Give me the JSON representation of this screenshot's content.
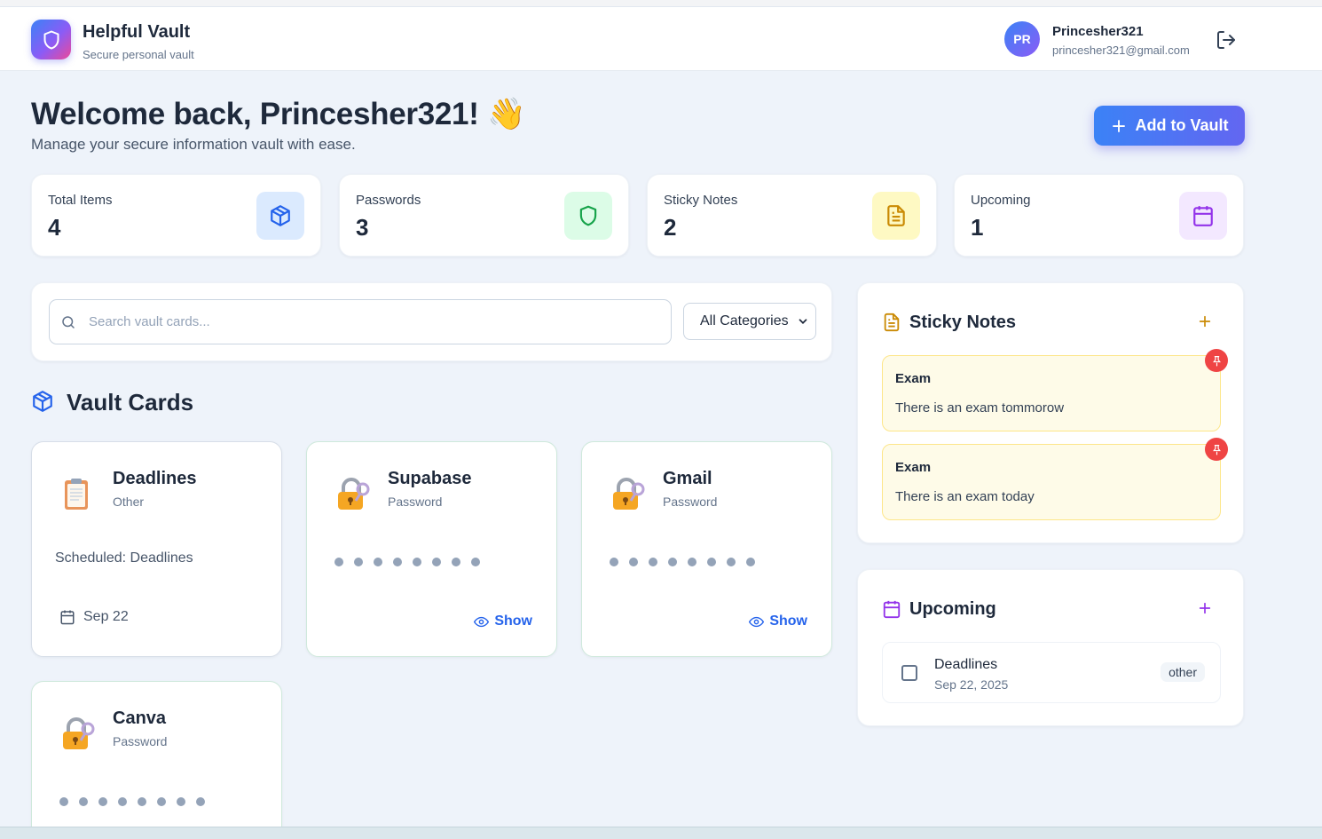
{
  "app": {
    "name": "Helpful Vault",
    "subtitle": "Secure personal vault"
  },
  "user": {
    "initials": "PR",
    "name": "Princesher321",
    "email": "princesher321@gmail.com"
  },
  "welcome": {
    "title": "Welcome back, Princesher321! 👋",
    "subtitle": "Manage your secure information vault with ease.",
    "add_label": "Add to Vault"
  },
  "stats": [
    {
      "label": "Total Items",
      "value": "4",
      "icon": "cube-icon",
      "color": "#2563eb",
      "bg": "#dbeafe"
    },
    {
      "label": "Passwords",
      "value": "3",
      "icon": "shield-icon",
      "color": "#16a34a",
      "bg": "#dcfce7"
    },
    {
      "label": "Sticky Notes",
      "value": "2",
      "icon": "note-icon",
      "color": "#ca8a04",
      "bg": "#fef9c3"
    },
    {
      "label": "Upcoming",
      "value": "1",
      "icon": "calendar-icon",
      "color": "#9333ea",
      "bg": "#f3e8ff"
    }
  ],
  "search": {
    "placeholder": "Search vault cards...",
    "category": "All Categories"
  },
  "vault": {
    "title": "Vault Cards",
    "cards": [
      {
        "title": "Deadlines",
        "category": "Other",
        "text": "Scheduled: Deadlines",
        "date": "Sep 22",
        "icon": "clipboard-icon"
      },
      {
        "title": "Supabase",
        "category": "Password",
        "show": "Show",
        "icon": "lock-icon"
      },
      {
        "title": "Gmail",
        "category": "Password",
        "show": "Show",
        "icon": "lock-icon"
      },
      {
        "title": "Canva",
        "category": "Password",
        "icon": "lock-icon"
      }
    ]
  },
  "sticky": {
    "title": "Sticky Notes",
    "notes": [
      {
        "title": "Exam",
        "body": "There is an exam tommorow"
      },
      {
        "title": "Exam",
        "body": "There is an exam today"
      }
    ]
  },
  "upcoming": {
    "title": "Upcoming",
    "items": [
      {
        "title": "Deadlines",
        "date": "Sep 22, 2025",
        "tag": "other"
      }
    ]
  },
  "colors": {
    "primary": "#3b82f6",
    "accent": "#6366f1",
    "note_bg": "#fefbe8",
    "pin": "#ef4444"
  }
}
